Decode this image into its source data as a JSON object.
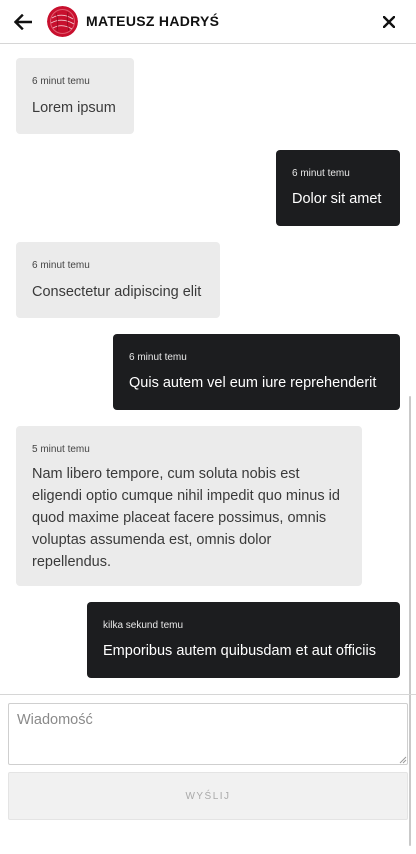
{
  "header": {
    "contact_name": "MATEUSZ HADRYŚ",
    "back_icon": "arrow-left-icon",
    "close_icon": "close-icon",
    "avatar_color": "#c8102e"
  },
  "messages": [
    {
      "direction": "incoming",
      "time": "6 minut temu",
      "text": "Lorem ipsum"
    },
    {
      "direction": "outgoing",
      "time": "6 minut temu",
      "text": "Dolor sit amet"
    },
    {
      "direction": "incoming",
      "time": "6 minut temu",
      "text": "Consectetur adipiscing elit"
    },
    {
      "direction": "outgoing",
      "time": "6 minut temu",
      "text": "Quis autem vel eum iure reprehenderit"
    },
    {
      "direction": "incoming",
      "time": "5 minut temu",
      "text": "Nam libero tempore, cum soluta nobis est eligendi optio cumque nihil impedit quo minus id quod maxime placeat facere possimus, omnis voluptas assumenda est, omnis dolor repellendus."
    },
    {
      "direction": "outgoing",
      "time": "kilka sekund temu",
      "text": "Emporibus autem quibusdam et aut officiis"
    }
  ],
  "composer": {
    "placeholder": "Wiadomość",
    "value": "",
    "send_label": "WYŚLIJ"
  },
  "colors": {
    "incoming_bubble": "#ebebeb",
    "outgoing_bubble": "#1c1d1f"
  }
}
